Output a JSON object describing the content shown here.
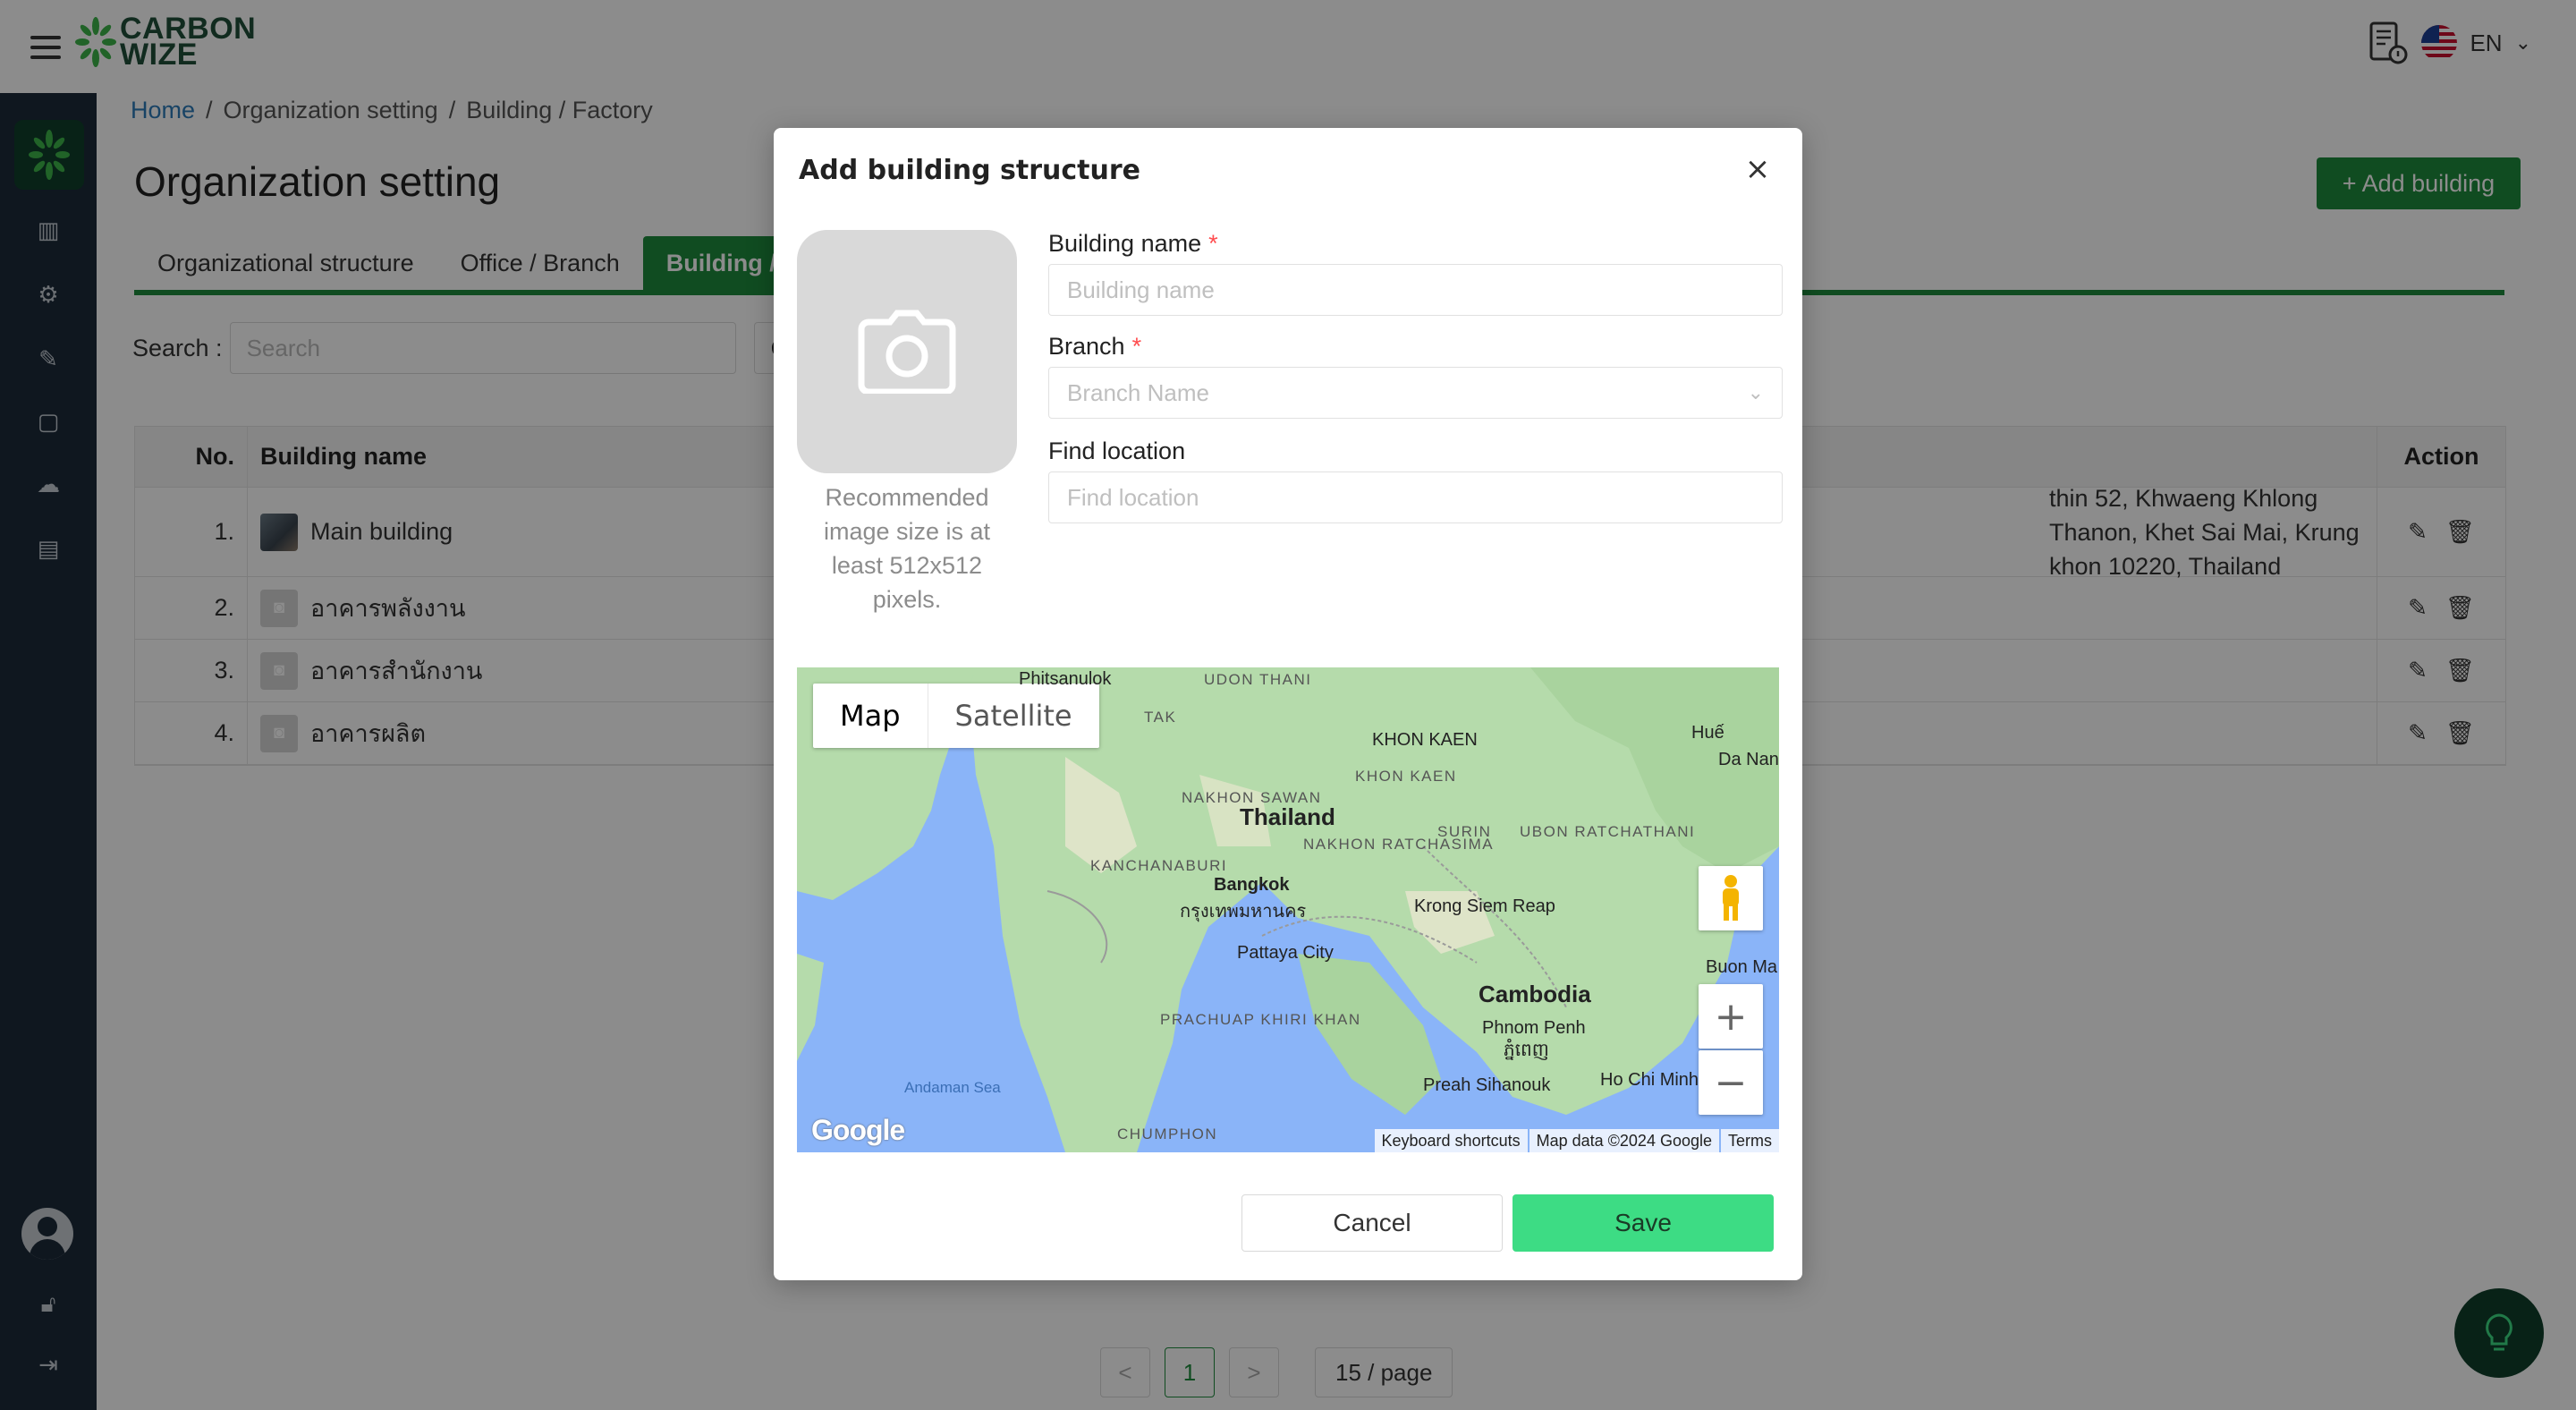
{
  "app": {
    "logo_line1": "CARBON",
    "logo_line2": "WIZE",
    "language": "EN"
  },
  "breadcrumb": {
    "home": "Home",
    "sep1": "/",
    "org": "Organization setting",
    "sep2": "/",
    "current": "Building / Factory"
  },
  "page": {
    "title": "Organization setting",
    "add_button": "+ Add building"
  },
  "tabs": [
    {
      "label": "Organizational structure"
    },
    {
      "label": "Office / Branch"
    },
    {
      "label": "Building /"
    }
  ],
  "search": {
    "label": "Search :",
    "placeholder": "Search",
    "filter_value": "C"
  },
  "table": {
    "headers": {
      "no": "No.",
      "name": "Building name",
      "action": "Action"
    },
    "rows": [
      {
        "no": "1.",
        "name": "Main building",
        "address": "thin 52, Khwaeng Khlong Thanon, Khet Sai Mai, Krung khon 10220, Thailand"
      },
      {
        "no": "2.",
        "name": "อาคารพลังงาน",
        "address": ""
      },
      {
        "no": "3.",
        "name": "อาคารสำนักงาน",
        "address": ""
      },
      {
        "no": "4.",
        "name": "อาคารผลิต",
        "address": ""
      }
    ]
  },
  "pagination": {
    "prev": "<",
    "current": "1",
    "next": ">",
    "page_size": "15 / page"
  },
  "modal": {
    "title": "Add building structure",
    "close": "×",
    "upload_hint": "Recommended image size is at least 512x512 pixels.",
    "building_name_label": "Building name",
    "building_name_placeholder": "Building name",
    "branch_label": "Branch",
    "branch_placeholder": "Branch Name",
    "location_label": "Find location",
    "location_placeholder": "Find location",
    "required_mark": "*",
    "cancel": "Cancel",
    "save": "Save"
  },
  "map": {
    "type_map": "Map",
    "type_satellite": "Satellite",
    "zoom_in": "+",
    "zoom_out": "−",
    "labels": {
      "thailand": "Thailand",
      "cambodia": "Cambodia",
      "bangkok": "Bangkok",
      "bangkok_th": "กรุงเทพมหานคร",
      "nakhon_sawan": "NAKHON SAWAN",
      "kanchanaburi": "KANCHANABURI",
      "nakhon_ratchasima": "NAKHON RATCHASIMA",
      "khon_kaen": "KHON KAEN",
      "udon_thani": "UDON THANI",
      "surin": "SURIN",
      "ubon": "UBON RATCHATHANI",
      "phitsanulok": "Phitsanulok",
      "tak": "TAK",
      "pattaya": "Pattaya City",
      "krong_siem_reap": "Krong Siem Reap",
      "phnom_penh": "Phnom Penh",
      "phnom_penh_km": "ភ្នំពេញ",
      "ho_chi_minh": "Ho Chi Minh City",
      "prachuap": "PRACHUAP KHIRI KHAN",
      "chumphon": "CHUMPHON",
      "andaman": "Andaman Sea",
      "preah": "Preah Sihanouk",
      "hue": "Huế",
      "da_nang": "Da Nang",
      "buon_ma": "Buon Ma",
      "google": "Google"
    },
    "footer": {
      "shortcuts": "Keyboard shortcuts",
      "data": "Map data ©2024 Google",
      "terms": "Terms"
    }
  },
  "colors": {
    "brand_green": "#1e8a3c",
    "save_green": "#3ddc84",
    "sidebar_bg": "#1c2b3a",
    "required_red": "#ff4d4f"
  }
}
